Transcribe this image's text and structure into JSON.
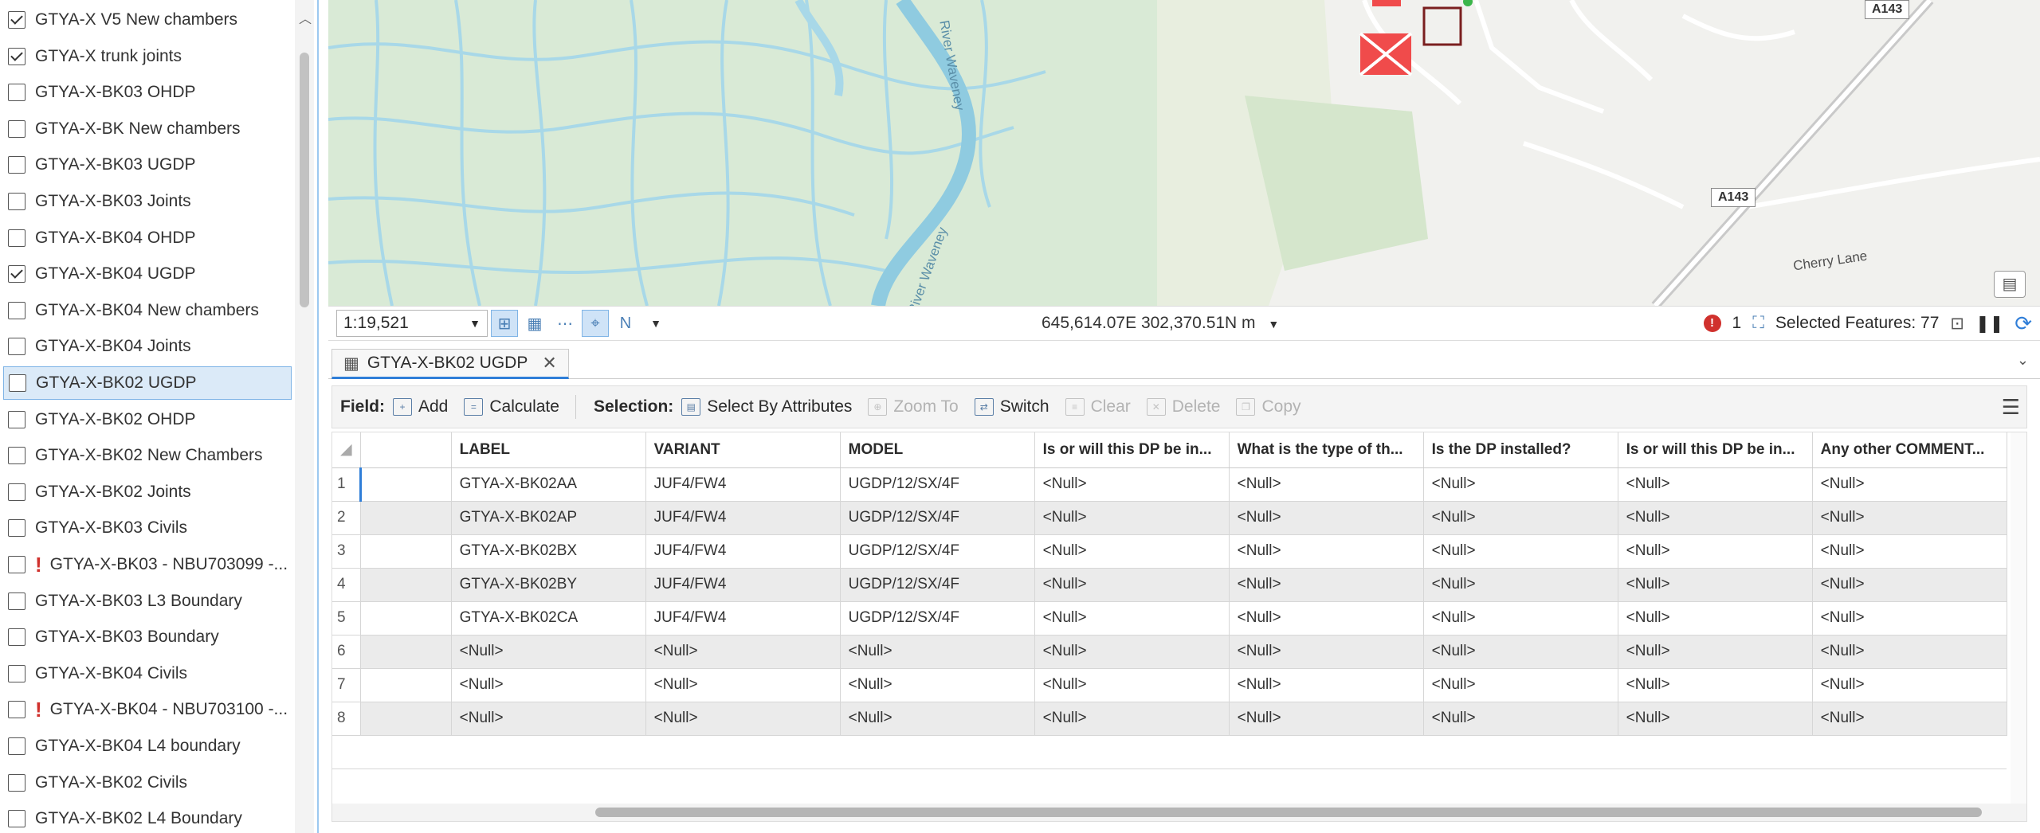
{
  "layers": [
    {
      "label": "GTYA-X V5 New chambers",
      "checked": true,
      "warning": false
    },
    {
      "label": "GTYA-X trunk joints",
      "checked": true,
      "warning": false
    },
    {
      "label": "GTYA-X-BK03 OHDP",
      "checked": false,
      "warning": false
    },
    {
      "label": "GTYA-X-BK New chambers",
      "checked": false,
      "warning": false
    },
    {
      "label": "GTYA-X-BK03 UGDP",
      "checked": false,
      "warning": false
    },
    {
      "label": "GTYA-X-BK03 Joints",
      "checked": false,
      "warning": false
    },
    {
      "label": "GTYA-X-BK04 OHDP",
      "checked": false,
      "warning": false
    },
    {
      "label": "GTYA-X-BK04 UGDP",
      "checked": true,
      "warning": false
    },
    {
      "label": "GTYA-X-BK04 New chambers",
      "checked": false,
      "warning": false
    },
    {
      "label": "GTYA-X-BK04 Joints",
      "checked": false,
      "warning": false
    },
    {
      "label": "GTYA-X-BK02 UGDP",
      "checked": false,
      "warning": false,
      "selected": true
    },
    {
      "label": "GTYA-X-BK02 OHDP",
      "checked": false,
      "warning": false
    },
    {
      "label": "GTYA-X-BK02 New Chambers",
      "checked": false,
      "warning": false
    },
    {
      "label": "GTYA-X-BK02 Joints",
      "checked": false,
      "warning": false
    },
    {
      "label": "GTYA-X-BK03 Civils",
      "checked": false,
      "warning": false
    },
    {
      "label": "GTYA-X-BK03 - NBU703099 -...",
      "checked": false,
      "warning": true
    },
    {
      "label": "GTYA-X-BK03 L3 Boundary",
      "checked": false,
      "warning": false
    },
    {
      "label": "GTYA-X-BK03 Boundary",
      "checked": false,
      "warning": false
    },
    {
      "label": "GTYA-X-BK04 Civils",
      "checked": false,
      "warning": false
    },
    {
      "label": "GTYA-X-BK04 - NBU703100 -...",
      "checked": false,
      "warning": true
    },
    {
      "label": "GTYA-X-BK04 L4 boundary",
      "checked": false,
      "warning": false
    },
    {
      "label": "GTYA-X-BK02 Civils",
      "checked": false,
      "warning": false
    },
    {
      "label": "GTYA-X-BK02 L4 Boundary",
      "checked": false,
      "warning": false
    }
  ],
  "map": {
    "road_a143_top": "A143",
    "road_a143_mid": "A143",
    "street_label": "Cherry Lane",
    "river_label_top": "River Waveney",
    "river_label_bottom": "River Waveney",
    "water_color": "#a8d8e8",
    "land_color": "#d9ead6"
  },
  "statusbar": {
    "scale": "1:19,521",
    "coordinates": "645,614.07E 302,370.51N m",
    "error_count": "1",
    "selected_features": "Selected Features: 77"
  },
  "table_tab": {
    "title": "GTYA-X-BK02 UGDP"
  },
  "toolbar": {
    "field_label": "Field:",
    "add": "Add",
    "calculate": "Calculate",
    "selection_label": "Selection:",
    "select_by_attributes": "Select By Attributes",
    "zoom_to": "Zoom To",
    "switch": "Switch",
    "clear": "Clear",
    "delete": "Delete",
    "copy": "Copy"
  },
  "table": {
    "columns": [
      "LABEL",
      "VARIANT",
      "MODEL",
      "Is or will this DP be in...",
      "What is the type of th...",
      "Is the DP installed?",
      "Is or will this DP be in...",
      "Any other COMMENT..."
    ],
    "rows": [
      {
        "num": "1",
        "cells": [
          "GTYA-X-BK02AA",
          "JUF4/FW4",
          "UGDP/12/SX/4F",
          "<Null>",
          "<Null>",
          "<Null>",
          "<Null>",
          "<Null>"
        ]
      },
      {
        "num": "2",
        "cells": [
          "GTYA-X-BK02AP",
          "JUF4/FW4",
          "UGDP/12/SX/4F",
          "<Null>",
          "<Null>",
          "<Null>",
          "<Null>",
          "<Null>"
        ]
      },
      {
        "num": "3",
        "cells": [
          "GTYA-X-BK02BX",
          "JUF4/FW4",
          "UGDP/12/SX/4F",
          "<Null>",
          "<Null>",
          "<Null>",
          "<Null>",
          "<Null>"
        ]
      },
      {
        "num": "4",
        "cells": [
          "GTYA-X-BK02BY",
          "JUF4/FW4",
          "UGDP/12/SX/4F",
          "<Null>",
          "<Null>",
          "<Null>",
          "<Null>",
          "<Null>"
        ]
      },
      {
        "num": "5",
        "cells": [
          "GTYA-X-BK02CA",
          "JUF4/FW4",
          "UGDP/12/SX/4F",
          "<Null>",
          "<Null>",
          "<Null>",
          "<Null>",
          "<Null>"
        ]
      },
      {
        "num": "6",
        "cells": [
          "<Null>",
          "<Null>",
          "<Null>",
          "<Null>",
          "<Null>",
          "<Null>",
          "<Null>",
          "<Null>"
        ]
      },
      {
        "num": "7",
        "cells": [
          "<Null>",
          "<Null>",
          "<Null>",
          "<Null>",
          "<Null>",
          "<Null>",
          "<Null>",
          "<Null>"
        ]
      },
      {
        "num": "8",
        "cells": [
          "<Null>",
          "<Null>",
          "<Null>",
          "<Null>",
          "<Null>",
          "<Null>",
          "<Null>",
          "<Null>"
        ]
      }
    ]
  }
}
